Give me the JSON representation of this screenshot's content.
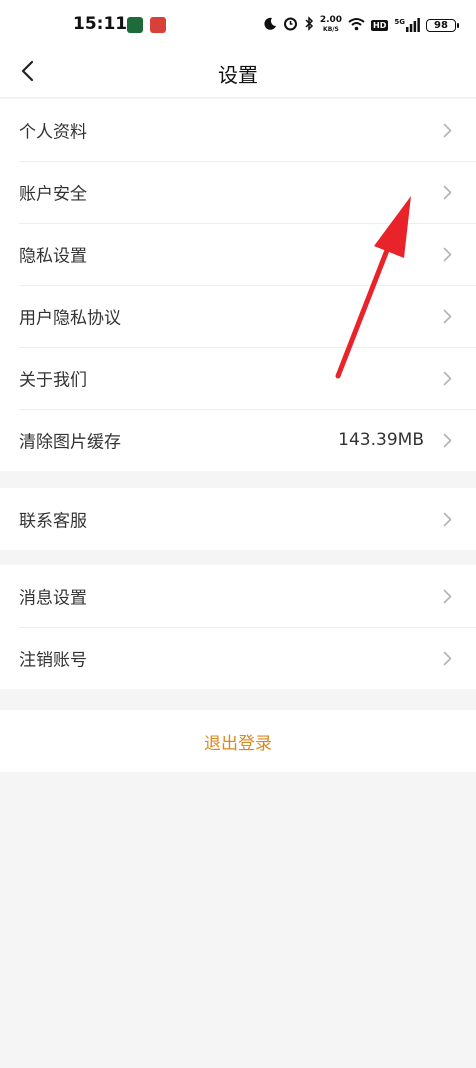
{
  "status_bar": {
    "time": "15:11",
    "net_speed_value": "2.00",
    "net_speed_unit": "KB/S",
    "hd_label": "HD",
    "signal_label": "5G",
    "battery": "98"
  },
  "header": {
    "title": "设置"
  },
  "groups": [
    {
      "items": [
        {
          "label": "个人资料"
        },
        {
          "label": "账户安全"
        },
        {
          "label": "隐私设置"
        },
        {
          "label": "用户隐私协议"
        },
        {
          "label": "关于我们"
        },
        {
          "label": "清除图片缓存",
          "value": "143.39MB"
        }
      ]
    },
    {
      "items": [
        {
          "label": "联系客服"
        }
      ]
    },
    {
      "items": [
        {
          "label": "消息设置"
        },
        {
          "label": "注销账号"
        }
      ]
    }
  ],
  "logout_label": "退出登录",
  "colors": {
    "accent": "#d98a1f",
    "annotation_arrow": "#e8242a",
    "background": "#f5f5f5"
  }
}
